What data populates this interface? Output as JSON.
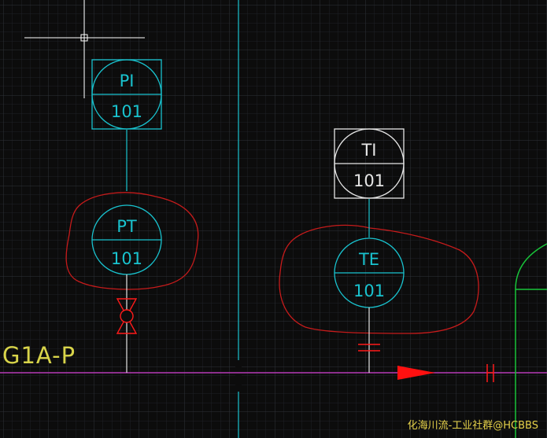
{
  "colors": {
    "background": "#0c0c0c",
    "grid_minor": "#1e2126",
    "grid_major": "#2e3238",
    "instrument": "#19c3cf",
    "instrument_alt": "#e6e6e6",
    "revision_cloud": "#c61b1b",
    "process_line": "#b53ab5",
    "flow_arrow": "#ff1010",
    "vessel": "#18c43a",
    "line_label": "#d8d44a",
    "watermark": "#e6d24a",
    "crosshair": "#ffffff"
  },
  "instruments": [
    {
      "id": "pi-101",
      "tag": "PI",
      "number": "101",
      "shape": "square-circle",
      "color_key": "instrument"
    },
    {
      "id": "pt-101",
      "tag": "PT",
      "number": "101",
      "shape": "circle",
      "color_key": "instrument"
    },
    {
      "id": "ti-101",
      "tag": "TI",
      "number": "101",
      "shape": "square-circle",
      "color_key": "instrument_alt"
    },
    {
      "id": "te-101",
      "tag": "TE",
      "number": "101",
      "shape": "circle",
      "color_key": "instrument"
    }
  ],
  "line_label": "G1A-P",
  "watermark": "化海川流-工业社群@HCBBS"
}
